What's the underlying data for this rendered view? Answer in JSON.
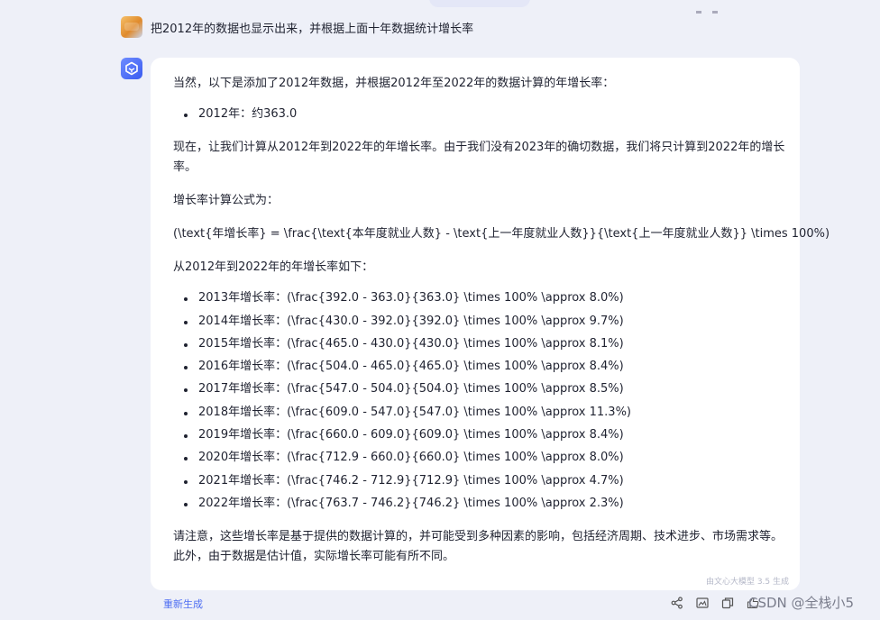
{
  "conversation": {
    "user_message": "把2012年的数据也显示出来，并根据上面十年数据统计增长率",
    "assistant": {
      "intro": "当然，以下是添加了2012年数据，并根据2012年至2022年的数据计算的年增长率：",
      "data_2012": "2012年：约363.0",
      "note": "现在，让我们计算从2012年到2022年的年增长率。由于我们没有2023年的确切数据，我们将只计算到2022年的增长率。",
      "formula_label": "增长率计算公式为：",
      "formula": "(\\text{年增长率} = \\frac{\\text{本年度就业人数} - \\text{上一年度就业人数}}{\\text{上一年度就业人数}} \\times 100%)",
      "growth_heading": "从2012年到2022年的年增长率如下：",
      "growth_rates": [
        "2013年增长率：(\\frac{392.0 - 363.0}{363.0} \\times 100% \\approx 8.0%)",
        "2014年增长率：(\\frac{430.0 - 392.0}{392.0} \\times 100% \\approx 9.7%)",
        "2015年增长率：(\\frac{465.0 - 430.0}{430.0} \\times 100% \\approx 8.1%)",
        "2016年增长率：(\\frac{504.0 - 465.0}{465.0} \\times 100% \\approx 8.4%)",
        "2017年增长率：(\\frac{547.0 - 504.0}{504.0} \\times 100% \\approx 8.5%)",
        "2018年增长率：(\\frac{609.0 - 547.0}{547.0} \\times 100% \\approx 11.3%)",
        "2019年增长率：(\\frac{660.0 - 609.0}{609.0} \\times 100% \\approx 8.4%)",
        "2020年增长率：(\\frac{712.9 - 660.0}{660.0} \\times 100% \\approx 8.0%)",
        "2021年增长率：(\\frac{746.2 - 712.9}{712.9} \\times 100% \\approx 4.7%)",
        "2022年增长率：(\\frac{763.7 - 746.2}{746.2} \\times 100% \\approx 2.3%)"
      ],
      "closing": "请注意，这些增长率是基于提供的数据计算的，并可能受到多种因素的影响，包括经济周期、技术进步、市场需求等。此外，由于数据是估计值，实际增长率可能有所不同。",
      "model_note": "由文心大模型 3.5 生成"
    },
    "regenerate_label": "重新生成"
  },
  "watermark": "CSDN @全栈小5",
  "icons": [
    "share-icon",
    "image-icon",
    "copy-icon",
    "thumbs-up-icon",
    "thumbs-down-icon"
  ],
  "colors": {
    "accent": "#4e6ef2",
    "background": "#eef0f8",
    "card": "#ffffff"
  }
}
